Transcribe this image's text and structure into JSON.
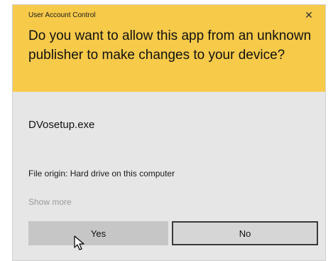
{
  "dialog": {
    "window_title": "User Account Control",
    "close_glyph": "✕",
    "question": "Do you want to allow this app from an unknown publisher to make changes to your device?",
    "app_name": "DVosetup.exe",
    "file_origin": "File origin: Hard drive on this computer",
    "show_more": "Show more",
    "buttons": {
      "yes": "Yes",
      "no": "No"
    }
  },
  "colors": {
    "header": "#f7ca4a",
    "body": "#e6e6e6",
    "yes_button": "#c6c6c6",
    "no_button": "#d6d6d6"
  },
  "icons": {
    "close": "close-icon",
    "cursor": "mouse-pointer-icon"
  }
}
